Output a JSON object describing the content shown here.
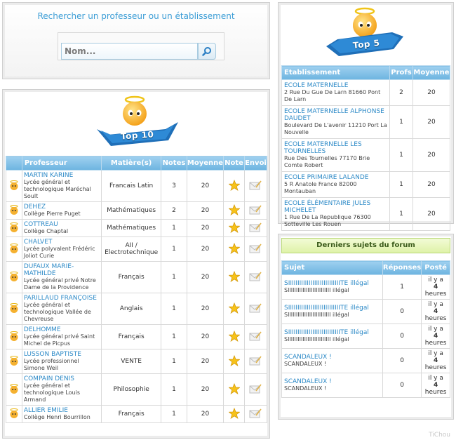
{
  "search": {
    "title": "Rechercher un professeur ou un établissement",
    "placeholder": "Nom..."
  },
  "top10": {
    "badge": "Top 10",
    "headers": [
      "Professeur",
      "Matière(s)",
      "Notes",
      "Moyenne",
      "Note",
      "Envoi"
    ],
    "rows": [
      {
        "name": "MARTIN KARINE",
        "school": "Lycée général et technologique Maréchal Soult",
        "subject": "Francais Latin",
        "notes": "3",
        "avg": "20"
      },
      {
        "name": "DEHEZ",
        "school": "Collège Pierre Puget",
        "subject": "Mathématiques",
        "notes": "2",
        "avg": "20"
      },
      {
        "name": "COTTREAU",
        "school": "Collège Chaptal",
        "subject": "Mathématiques",
        "notes": "1",
        "avg": "20"
      },
      {
        "name": "CHALVET",
        "school": "Lycée polyvalent Frédéric Joliot Curie",
        "subject": "AII / Electrotechnique",
        "notes": "1",
        "avg": "20"
      },
      {
        "name": "DUFAUX MARIE-MATHILDE",
        "school": "Lycée général privé Notre Dame de la Providence",
        "subject": "Français",
        "notes": "1",
        "avg": "20"
      },
      {
        "name": "PARILLAUD FRANÇOISE",
        "school": "Lycée général et technologique Vallée de Chevreuse",
        "subject": "Anglais",
        "notes": "1",
        "avg": "20"
      },
      {
        "name": "DELHOMME",
        "school": "Lycée général privé Saint Michel de Picpus",
        "subject": "Français",
        "notes": "1",
        "avg": "20"
      },
      {
        "name": "LUSSON BAPTISTE",
        "school": "Lycée professionnel Simone Weil",
        "subject": "VENTE",
        "notes": "1",
        "avg": "20"
      },
      {
        "name": "COMPAIN DENIS",
        "school": "Lycée général et technologique Louis Armand",
        "subject": "Philosophie",
        "notes": "1",
        "avg": "20"
      },
      {
        "name": "ALLIER EMILIE",
        "school": "Collège Henri Bourrillon",
        "subject": "Français",
        "notes": "1",
        "avg": "20"
      }
    ]
  },
  "top5": {
    "badge": "Top 5",
    "headers": [
      "Etablissement",
      "Profs",
      "Moyenne"
    ],
    "rows": [
      {
        "name": "ECOLE MATERNELLE",
        "address": "2 Rue Du Gue De Larn 81660 Pont De Larn",
        "profs": "2",
        "avg": "20"
      },
      {
        "name": "ECOLE MATERNELLE ALPHONSE DAUDET",
        "address": "Boulevard De L'avenir 11210 Port La Nouvelle",
        "profs": "1",
        "avg": "20"
      },
      {
        "name": "ECOLE MATERNELLE LES TOURNELLES",
        "address": "Rue Des Tournelles 77170 Brie Comte Robert",
        "profs": "1",
        "avg": "20"
      },
      {
        "name": "ECOLE PRIMAIRE LALANDE",
        "address": "5 R Anatole France 82000 Montauban",
        "profs": "1",
        "avg": "20"
      },
      {
        "name": "ECOLE ÉLÉMENTAIRE JULES MICHELET",
        "address": "1 Rue De La Republique 76300 Sotteville Les Rouen",
        "profs": "1",
        "avg": "20"
      }
    ]
  },
  "forum": {
    "title": "Derniers sujets du forum",
    "headers": [
      "Sujet",
      "Réponses",
      "Posté"
    ],
    "rows": [
      {
        "subject": "SIIIIIIIIIIIIIIIIIIIIIIIIIIIITE illégal",
        "preview": "SIIIIIIIIIIIIIIIIIIIIIIIIII illégal",
        "replies": "1",
        "posted_a": "il y a",
        "posted_b": "4",
        "posted_c": "heures"
      },
      {
        "subject": "SIIIIIIIIIIIIIIIIIIIIIIIIIIIITE illégal",
        "preview": "SIIIIIIIIIIIIIIIIIIIIIIIIII illégal",
        "replies": "0",
        "posted_a": "il y a",
        "posted_b": "4",
        "posted_c": "heures"
      },
      {
        "subject": "SIIIIIIIIIIIIIIIIIIIIIIIIIIIITE illégal",
        "preview": "SIIIIIIIIIIIIIIIIIIIIIIIIII illégal",
        "replies": "0",
        "posted_a": "il y a",
        "posted_b": "4",
        "posted_c": "heures"
      },
      {
        "subject": "SCANDALEUX !",
        "preview": "SCANDALEUX !",
        "replies": "0",
        "posted_a": "il y a",
        "posted_b": "4",
        "posted_c": "heures"
      },
      {
        "subject": "SCANDALEUX !",
        "preview": "SCANDALEUX !",
        "replies": "0",
        "posted_a": "il y a",
        "posted_b": "4",
        "posted_c": "heures"
      }
    ]
  },
  "watermark": "TiChou",
  "colors": {
    "accent": "#3b9dd6",
    "header": "#6db4e0",
    "link": "#2d8ac7",
    "forum_green": "#dff2a8"
  },
  "icons": {
    "angel": "angel-smiley-icon",
    "star": "star-icon",
    "send": "envelope-icon",
    "search": "magnifier-icon"
  }
}
